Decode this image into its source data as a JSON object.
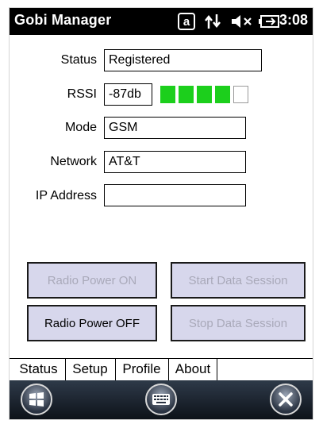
{
  "statusbar": {
    "app_title": "Gobi Manager",
    "time": "3:08",
    "icons": [
      "a-key-icon",
      "data-transfer-icon",
      "speaker-muted-icon",
      "battery-charging-icon"
    ]
  },
  "form": {
    "status": {
      "label": "Status",
      "value": "Registered"
    },
    "rssi": {
      "label": "RSSI",
      "value": "-87db",
      "signal_bars_filled": 4,
      "signal_bars_total": 5
    },
    "mode": {
      "label": "Mode",
      "value": "GSM"
    },
    "network": {
      "label": "Network",
      "value": "AT&T"
    },
    "ip_address": {
      "label": "IP Address",
      "value": ""
    }
  },
  "buttons": {
    "radio_power_on": {
      "label": "Radio Power ON",
      "enabled": false
    },
    "start_data_session": {
      "label": "Start Data Session",
      "enabled": false
    },
    "radio_power_off": {
      "label": "Radio Power OFF",
      "enabled": true
    },
    "stop_data_session": {
      "label": "Stop Data Session",
      "enabled": false
    }
  },
  "tabs": [
    {
      "label": "Status",
      "active": true
    },
    {
      "label": "Setup",
      "active": false
    },
    {
      "label": "Profile",
      "active": false
    },
    {
      "label": "About",
      "active": false
    }
  ],
  "navbar": {
    "icons": [
      "windows-start-icon",
      "keyboard-icon",
      "close-icon"
    ]
  },
  "colors": {
    "signal_on": "#1ccf1c",
    "button_face": "#d7d7ec",
    "disabled_text": "#a9a9b9"
  }
}
